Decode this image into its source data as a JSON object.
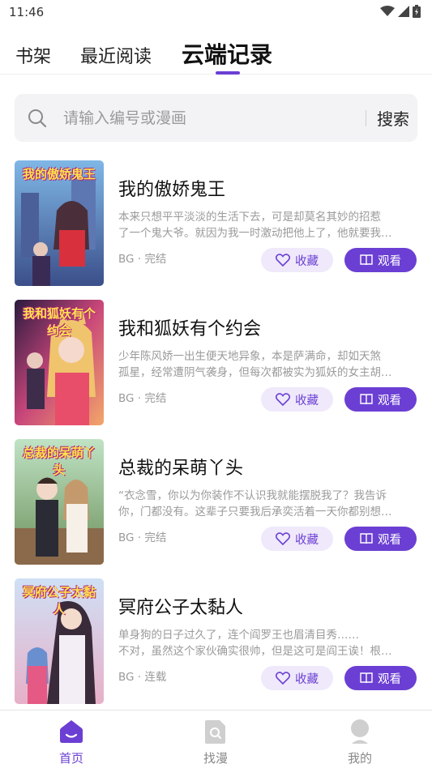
{
  "status_bar": {
    "time": "11:46"
  },
  "tabs": [
    {
      "label": "书架"
    },
    {
      "label": "最近阅读"
    },
    {
      "label": "云端记录"
    }
  ],
  "search": {
    "placeholder": "请输入编号或漫画",
    "button_label": "搜索"
  },
  "items": [
    {
      "title": "我的傲娇鬼王",
      "cover_text": "我的傲娇鬼王",
      "desc_line1": "本来只想平平淡淡的生活下去，可是却莫名其妙的招惹",
      "desc_line2": "了一个鬼大爷。就因为我一时激动把他上了，他就要我…",
      "meta": "BG · 完结",
      "fav_label": "收藏",
      "read_label": "观看"
    },
    {
      "title": "我和狐妖有个约会",
      "cover_text": "我和狐妖有个约会",
      "desc_line1": "少年陈风娇一出生便天地异象，本是萨满命，却如天煞",
      "desc_line2": "孤星，经常遭阴气袭身，但每次都被实为狐妖的女主胡…",
      "meta": "BG · 完结",
      "fav_label": "收藏",
      "read_label": "观看"
    },
    {
      "title": "总裁的呆萌丫头",
      "cover_text": "总裁的呆萌丫头",
      "desc_line1": "“衣念雪，你以为你装作不认识我就能摆脱我了？我告诉",
      "desc_line2": "你，门都没有。这辈子只要我后承奕活着一天你都别想…",
      "meta": "BG · 完结",
      "fav_label": "收藏",
      "read_label": "观看"
    },
    {
      "title": "冥府公子太黏人",
      "cover_text": "冥府公子太黏人",
      "desc_line1": "单身狗的日子过久了，连个阎罗王也眉清目秀……",
      "desc_line2": "不对，虽然这个家伙确实很帅，但是这可是阎王诶！根…",
      "meta": "BG · 连载",
      "fav_label": "收藏",
      "read_label": "观看"
    }
  ],
  "bottom_nav": [
    {
      "label": "首页",
      "icon": "home-icon"
    },
    {
      "label": "找漫",
      "icon": "find-comic-icon"
    },
    {
      "label": "我的",
      "icon": "profile-icon"
    }
  ],
  "colors": {
    "accent": "#6b3fd3",
    "accent_light": "#efe9fb",
    "muted_text": "#9a9a9a"
  }
}
